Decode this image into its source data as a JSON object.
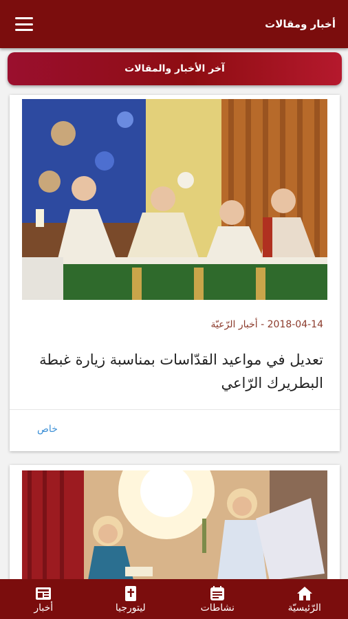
{
  "app_bar": {
    "title": "أخبار ومقالات"
  },
  "section_header": {
    "label": "آخر الأخبار والمقالات"
  },
  "articles": [
    {
      "date": "2018-04-14",
      "category": "أخبار الرّعيّة",
      "meta_separator": " - ",
      "title": "تعديل في مواعيد القدّاسات بمناسبة زيارة غبطة البطريرك الرّاعي",
      "tag": "خاص",
      "image_icon": "church-mass-photo"
    },
    {
      "image_icon": "annunciation-painting"
    }
  ],
  "bottom_nav": [
    {
      "label": "الرّئيسيّة",
      "icon": "home-icon"
    },
    {
      "label": "نشاطات",
      "icon": "calendar-icon"
    },
    {
      "label": "ليتورجيا",
      "icon": "book-cross-icon"
    },
    {
      "label": "أخبار",
      "icon": "news-icon"
    }
  ],
  "colors": {
    "primary": "#7b0d0d",
    "header_gradient_start": "#9a0f2e",
    "header_gradient_end": "#b5192d",
    "link": "#3b8fd6",
    "meta": "#8b3a2b"
  }
}
